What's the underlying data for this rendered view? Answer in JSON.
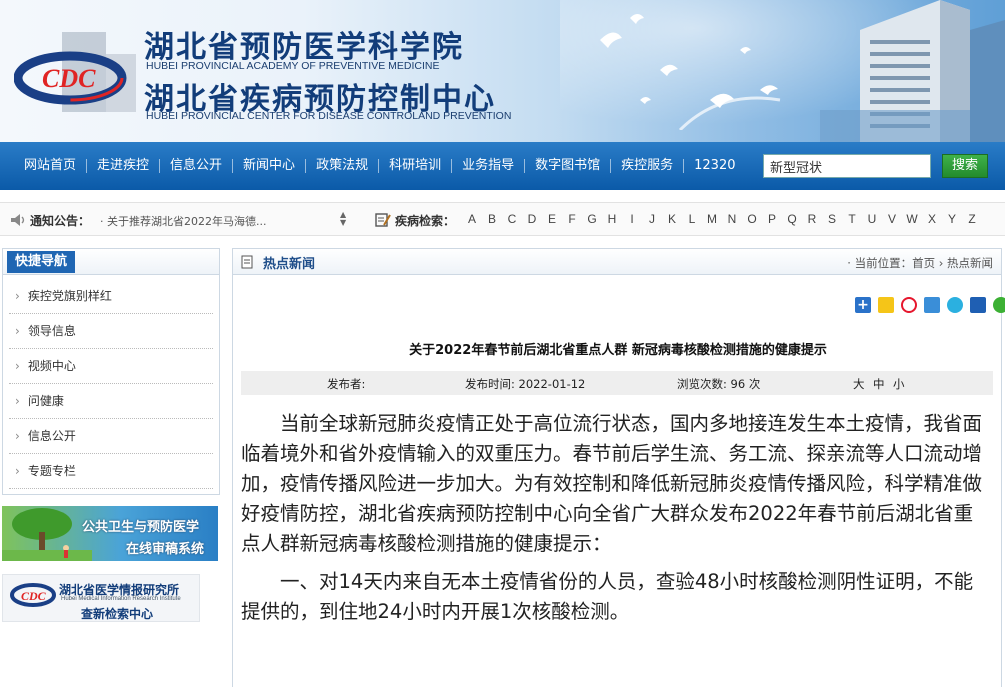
{
  "header": {
    "title_cn_1": "湖北省预防医学科学院",
    "title_en_1": "HUBEI PROVINCIAL ACADEMY OF PREVENTIVE MEDICINE",
    "title_cn_2": "湖北省疾病预防控制中心",
    "title_en_2": "HUBEI PROVINCIAL CENTER FOR DISEASE CONTROLAND PREVENTION",
    "logo_icon": "cdc-logo-icon"
  },
  "nav": {
    "items": [
      "网站首页",
      "走进疾控",
      "信息公开",
      "新闻中心",
      "政策法规",
      "科研培训",
      "业务指导",
      "数字图书馆",
      "疾控服务",
      "12320"
    ],
    "search_value": "新型冠状",
    "search_button": "搜索"
  },
  "notice": {
    "label": "通知公告：",
    "text": "· 关于推荐湖北省2022年马海德...",
    "disease_label": "疾病检索：",
    "letters": [
      "A",
      "B",
      "C",
      "D",
      "E",
      "F",
      "G",
      "H",
      "I",
      "J",
      "K",
      "L",
      "M",
      "N",
      "O",
      "P",
      "Q",
      "R",
      "S",
      "T",
      "U",
      "V",
      "W",
      "X",
      "Y",
      "Z"
    ]
  },
  "sidebar": {
    "title": "快捷导航",
    "items": [
      "疾控党旗别样红",
      "领导信息",
      "视频中心",
      "问健康",
      "信息公开",
      "专题专栏"
    ],
    "ad1_line1": "公共卫生与预防医学",
    "ad1_line2": "在线审稿系统",
    "ad2_line1": "湖北省医学情报研究所",
    "ad2_line2": "Hubei Medical Information Research Institute",
    "ad2_line3": "查新检索中心"
  },
  "main": {
    "section_title": "热点新闻",
    "breadcrumb_prefix": "· 当前位置：",
    "breadcrumb_home": "首页",
    "breadcrumb_sep": " › ",
    "breadcrumb_current": "热点新闻",
    "share_icons": [
      "share-plus-icon",
      "qzone-icon",
      "weibo-icon",
      "tencent-weibo-icon",
      "qq-icon",
      "renren-icon",
      "wechat-icon"
    ],
    "article_title": "关于2022年春节前后湖北省重点人群  新冠病毒核酸检测措施的健康提示",
    "meta": {
      "publisher": "发布者:",
      "date": "发布时间: 2022-01-12",
      "views": "浏览次数: 96 次",
      "size_large": "大",
      "size_medium": "中",
      "size_small": "小"
    },
    "paragraphs": [
      "当前全球新冠肺炎疫情正处于高位流行状态，国内多地接连发生本土疫情，我省面临着境外和省外疫情输入的双重压力。春节前后学生流、务工流、探亲流等人口流动增加，疫情传播风险进一步加大。为有效控制和降低新冠肺炎疫情传播风险，科学精准做好疫情防控，湖北省疾病预防控制中心向全省广大群众发布2022年春节前后湖北省重点人群新冠病毒核酸检测措施的健康提示：",
      "一、对14天内来自无本土疫情省份的人员，查验48小时核酸检测阴性证明，不能提供的，到住地24小时内开展1次核酸检测。"
    ]
  }
}
